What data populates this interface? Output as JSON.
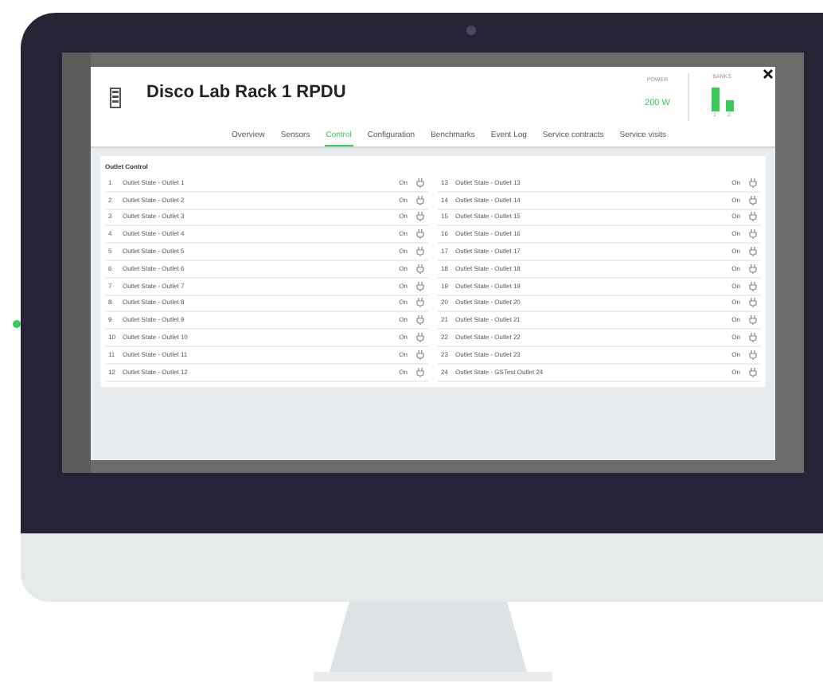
{
  "device": {
    "title": "Disco Lab Rack 1 RPDU"
  },
  "power": {
    "label": "POWER",
    "value": "200 W"
  },
  "banks": {
    "label": "BANKS",
    "bars": [
      {
        "label": "1"
      },
      {
        "label": "2"
      }
    ]
  },
  "tabs": [
    {
      "label": "Overview",
      "selected": false
    },
    {
      "label": "Sensors",
      "selected": false
    },
    {
      "label": "Control",
      "selected": true
    },
    {
      "label": "Configuration",
      "selected": false
    },
    {
      "label": "Benchmarks",
      "selected": false
    },
    {
      "label": "Event Log",
      "selected": false
    },
    {
      "label": "Service contracts",
      "selected": false
    },
    {
      "label": "Service visits",
      "selected": false
    }
  ],
  "panel": {
    "title": "Outlet Control"
  },
  "outlets": [
    {
      "number": "1",
      "name": "Outlet State - Outlet 1",
      "state": "On"
    },
    {
      "number": "2",
      "name": "Outlet State - Outlet 2",
      "state": "On"
    },
    {
      "number": "3",
      "name": "Outlet State - Outlet 3",
      "state": "On"
    },
    {
      "number": "4",
      "name": "Outlet State - Outlet 4",
      "state": "On"
    },
    {
      "number": "5",
      "name": "Outlet State - Outlet 5",
      "state": "On"
    },
    {
      "number": "6",
      "name": "Outlet State - Outlet 6",
      "state": "On"
    },
    {
      "number": "7",
      "name": "Outlet State - Outlet 7",
      "state": "On"
    },
    {
      "number": "8",
      "name": "Outlet State - Outlet 8",
      "state": "On"
    },
    {
      "number": "9",
      "name": "Outlet State - Outlet 9",
      "state": "On"
    },
    {
      "number": "10",
      "name": "Outlet State - Outlet 10",
      "state": "On"
    },
    {
      "number": "11",
      "name": "Outlet State - Outlet 11",
      "state": "On"
    },
    {
      "number": "12",
      "name": "Outlet State - Outlet 12",
      "state": "On"
    },
    {
      "number": "13",
      "name": "Outlet State - Outlet 13",
      "state": "On"
    },
    {
      "number": "14",
      "name": "Outlet State - Outlet 14",
      "state": "On"
    },
    {
      "number": "15",
      "name": "Outlet State - Outlet 15",
      "state": "On"
    },
    {
      "number": "16",
      "name": "Outlet State - Outlet 16",
      "state": "On"
    },
    {
      "number": "17",
      "name": "Outlet State - Outlet 17",
      "state": "On"
    },
    {
      "number": "18",
      "name": "Outlet State - Outlet 18",
      "state": "On"
    },
    {
      "number": "19",
      "name": "Outlet State - Outlet 19",
      "state": "On"
    },
    {
      "number": "20",
      "name": "Outlet State - Outlet 20",
      "state": "On"
    },
    {
      "number": "21",
      "name": "Outlet State - Outlet 21",
      "state": "On"
    },
    {
      "number": "22",
      "name": "Outlet State - Outlet 22",
      "state": "On"
    },
    {
      "number": "23",
      "name": "Outlet State - Outlet 23",
      "state": "On"
    },
    {
      "number": "24",
      "name": "Outlet State - GSTest Outlet 24",
      "state": "On"
    }
  ]
}
